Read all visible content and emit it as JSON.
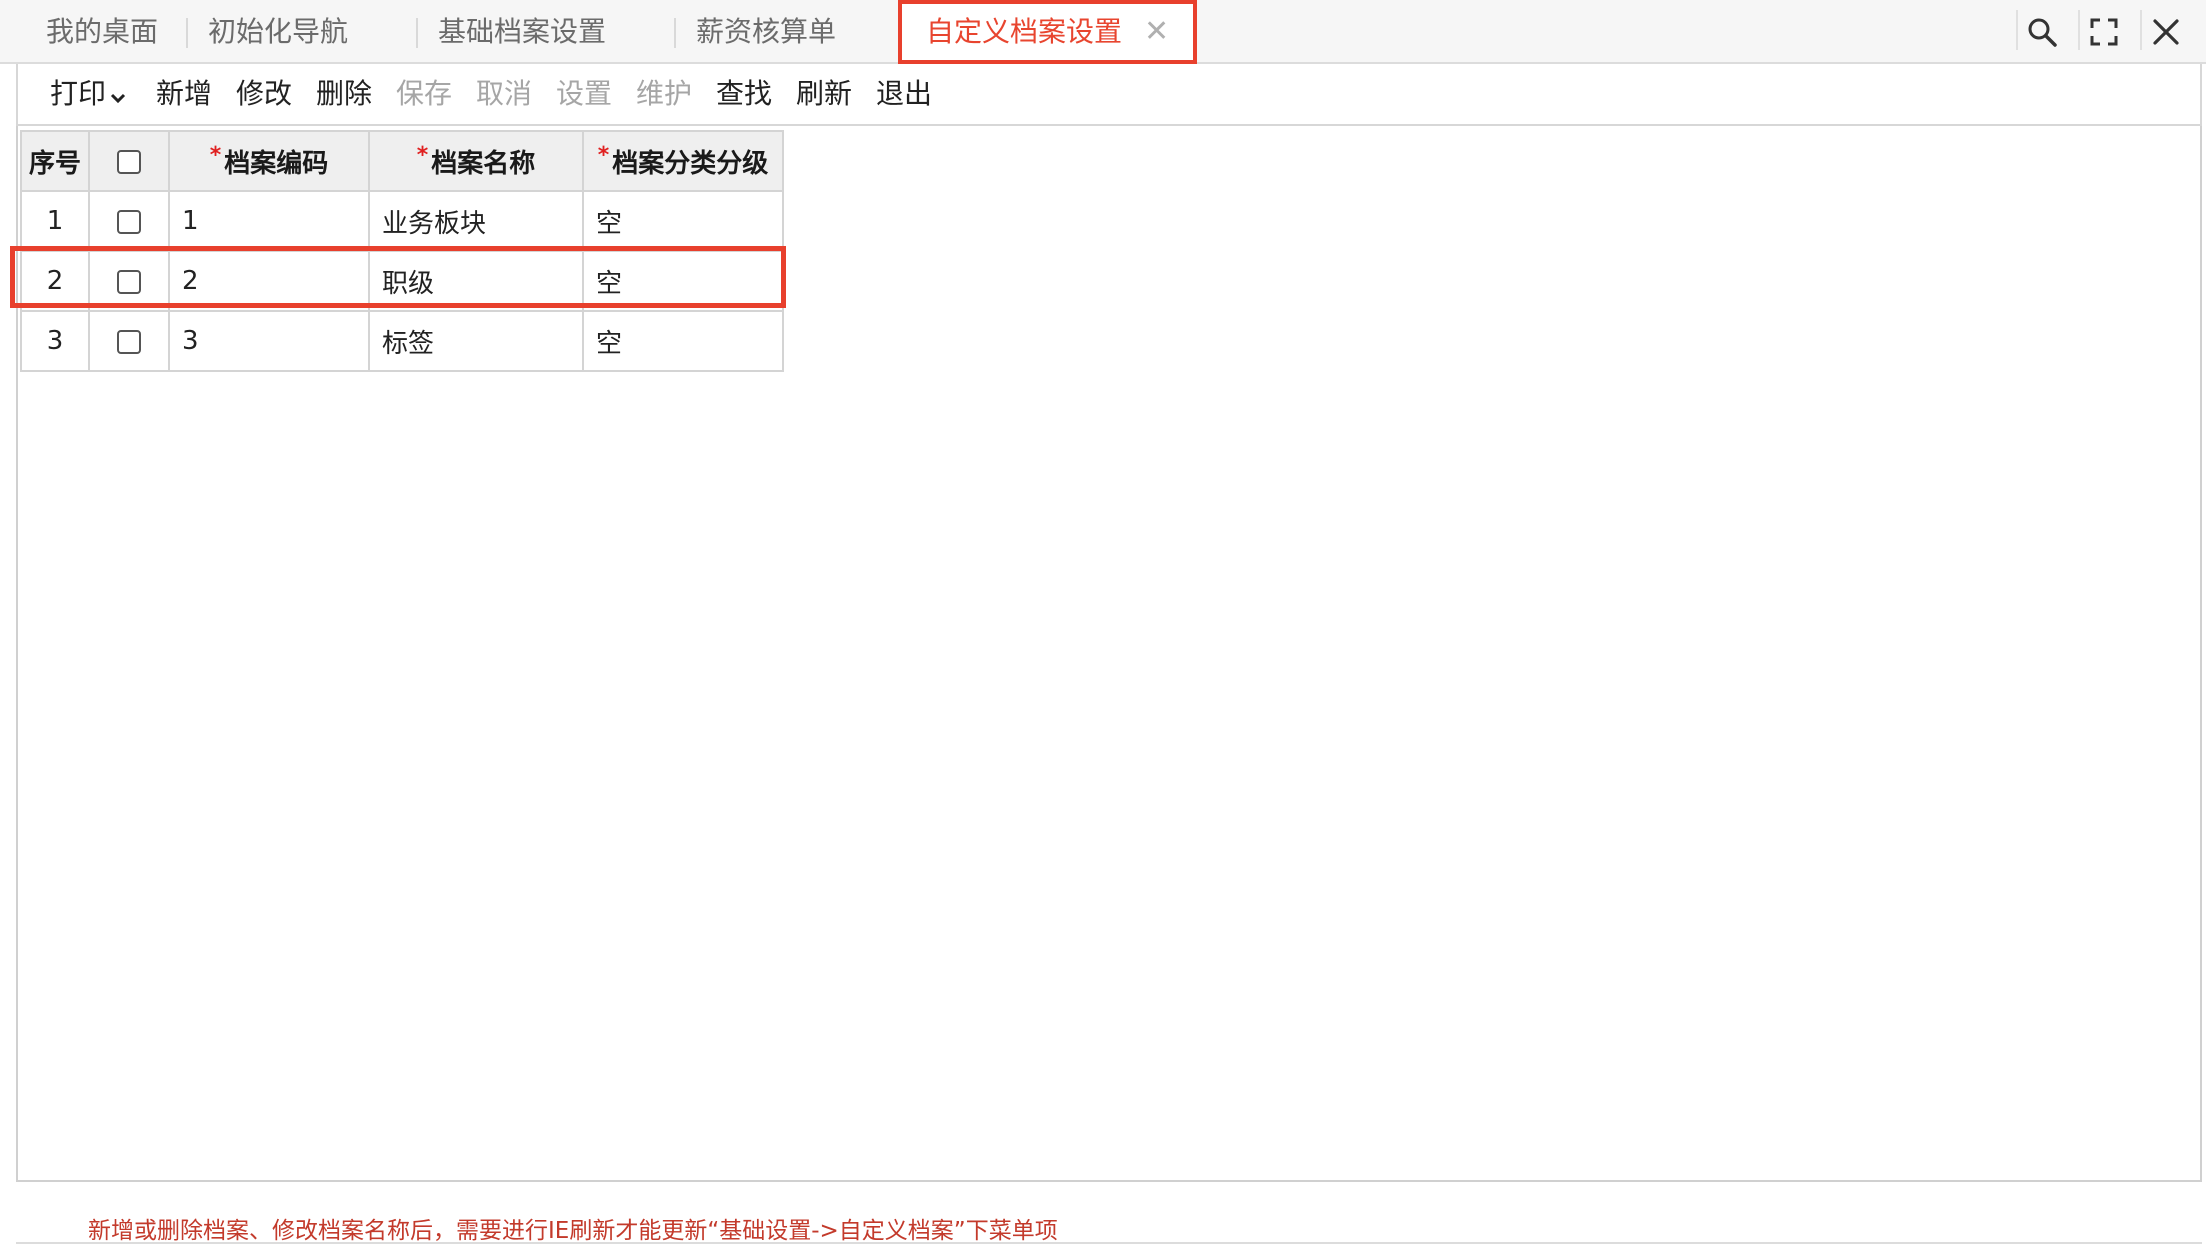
{
  "tabs": [
    {
      "label": "我的桌面"
    },
    {
      "label": "初始化导航"
    },
    {
      "label": "基础档案设置"
    },
    {
      "label": "薪资核算单"
    },
    {
      "label": "自定义档案设置",
      "active": true
    }
  ],
  "window_icons": [
    "search-icon",
    "fullscreen-icon",
    "close-icon"
  ],
  "toolbar": {
    "print": "打印",
    "add": "新增",
    "edit": "修改",
    "delete": "删除",
    "save": "保存",
    "cancel": "取消",
    "settings": "设置",
    "maintain": "维护",
    "find": "查找",
    "refresh": "刷新",
    "exit": "退出"
  },
  "table": {
    "headers": {
      "seq": "序号",
      "code": "档案编码",
      "name": "档案名称",
      "level": "档案分类分级"
    },
    "rows": [
      {
        "seq": "1",
        "code": "1",
        "name": "业务板块",
        "level": "空"
      },
      {
        "seq": "2",
        "code": "2",
        "name": "职级",
        "level": "空"
      },
      {
        "seq": "3",
        "code": "3",
        "name": "标签",
        "level": "空"
      }
    ]
  },
  "footer": {
    "note": "新增或删除档案、修改档案名称后，需要进行IE刷新才能更新“基础设置->自定义档案”下菜单项"
  },
  "colors": {
    "accent": "#e8402d",
    "required": "#e02020",
    "note_text": "#c33a2b",
    "disabled_text": "#a6a6a6"
  }
}
